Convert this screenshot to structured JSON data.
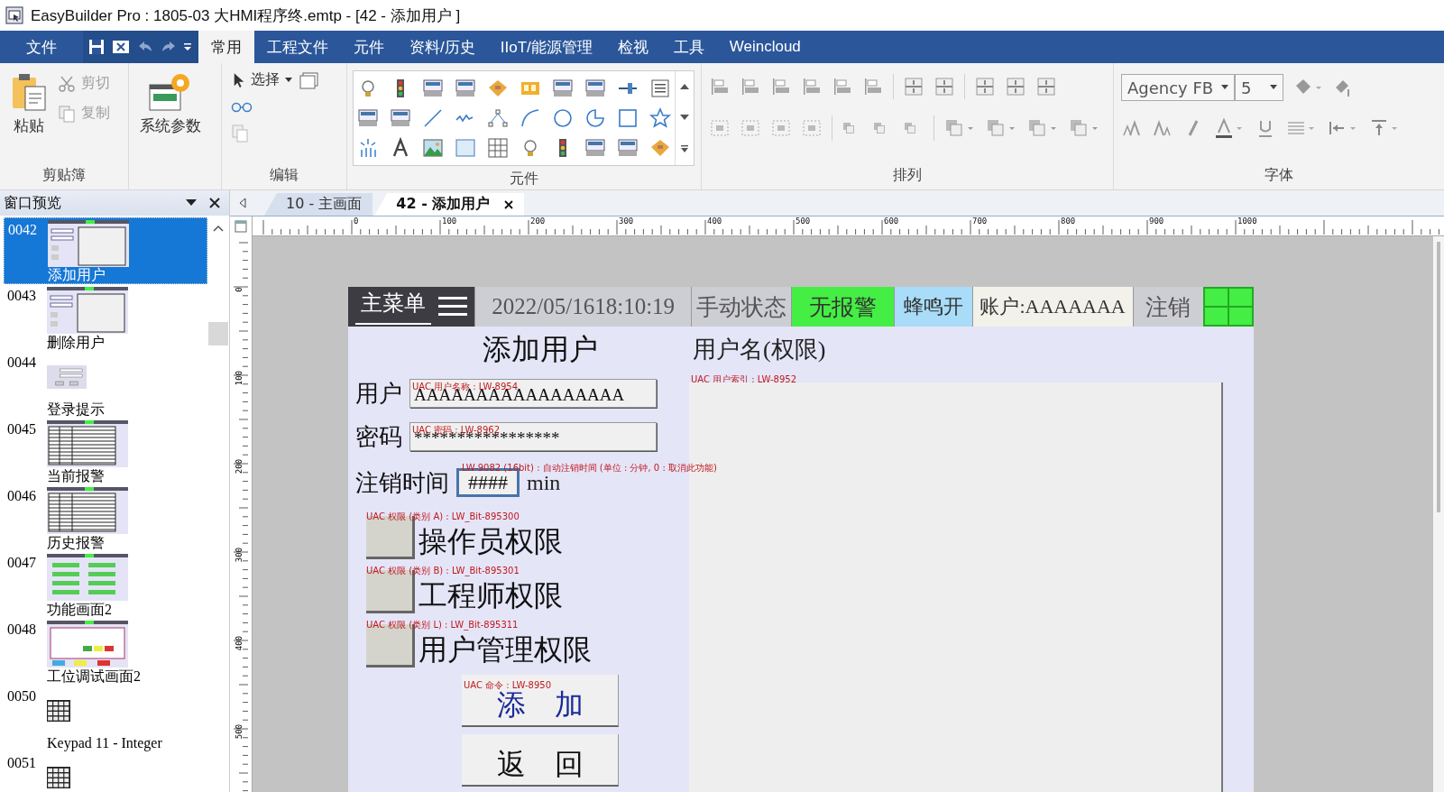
{
  "window": {
    "title": "EasyBuilder Pro : 1805-03 大HMI程序终.emtp - [42 - 添加用户 ]"
  },
  "menu": {
    "file": "文件",
    "tabs": [
      {
        "label": "常用",
        "selected": true
      },
      {
        "label": "工程文件",
        "selected": false
      },
      {
        "label": "元件",
        "selected": false
      },
      {
        "label": "资料/历史",
        "selected": false
      },
      {
        "label": "IIoT/能源管理",
        "selected": false
      },
      {
        "label": "检视",
        "selected": false
      },
      {
        "label": "工具",
        "selected": false
      },
      {
        "label": "Weincloud",
        "selected": false
      }
    ]
  },
  "ribbon": {
    "clipboard": {
      "label": "剪贴簿",
      "paste": {
        "label": "粘贴",
        "disabled": false
      },
      "actions": [
        {
          "label": "剪切",
          "disabled": true
        },
        {
          "label": "复制",
          "disabled": true
        }
      ]
    },
    "system": {
      "label": "系统参数"
    },
    "edit": {
      "label": "编辑",
      "select": "选择"
    },
    "objects": {
      "label": "元件"
    },
    "arrange": {
      "label": "排列"
    },
    "font": {
      "label": "字体",
      "family": "Agency FB",
      "size": "5"
    }
  },
  "window_preview": {
    "title": "窗口预览",
    "items": [
      {
        "number": "0042",
        "name": "添加用户",
        "kind": "form",
        "selected": true
      },
      {
        "number": "0043",
        "name": "删除用户",
        "kind": "form",
        "selected": false
      },
      {
        "number": "0044",
        "name": "登录提示",
        "kind": "dialog",
        "selected": false
      },
      {
        "number": "0045",
        "name": "当前报警",
        "kind": "table",
        "selected": false
      },
      {
        "number": "0046",
        "name": "历史报警",
        "kind": "table",
        "selected": false
      },
      {
        "number": "0047",
        "name": "功能画面2",
        "kind": "buttons",
        "selected": false
      },
      {
        "number": "0048",
        "name": "工位调试画面2",
        "kind": "panel",
        "selected": false
      },
      {
        "number": "0050",
        "name": "Keypad 11 - Integer",
        "kind": "keypad",
        "selected": false
      },
      {
        "number": "0051",
        "kind": "keypad",
        "selected": false
      }
    ]
  },
  "doc_tabs": [
    {
      "label": "10 - 主画面",
      "selected": false
    },
    {
      "label": "42 - 添加用户",
      "selected": true
    }
  ],
  "ruler": {
    "horizontal": [
      "0",
      "100",
      "200",
      "300",
      "400",
      "500",
      "600",
      "700",
      "800",
      "900",
      "1000"
    ],
    "vertical": [
      "0",
      "100",
      "200",
      "300",
      "400",
      "500"
    ]
  },
  "hmi": {
    "header": {
      "menu": "主菜单",
      "datetime": "2022/05/1618:10:19",
      "mode": "手动状态",
      "alarm": "无报警",
      "buzzer": "蜂鸣开",
      "account": "账户:AAAAAAA",
      "logout": "注销"
    },
    "title": "添加用户",
    "fields": [
      {
        "label": "用户",
        "tag": "UAC 用户名称 : LW-8954",
        "value": "AAAAAAAAAAAAAAAAA"
      },
      {
        "label": "密码",
        "tag": "UAC 密码 : LW-8962",
        "value": "*****************"
      }
    ],
    "timeout": {
      "label": "注销时间",
      "tag": "LW-9082 (16bit) : 自动注销时间 (单位 : 分钟, 0 : 取消此功能)",
      "value": "####",
      "unit": "min"
    },
    "permissions": [
      {
        "tag": "UAC 权限 (类别 A) : LW_Bit-895300",
        "label": "操作员权限"
      },
      {
        "tag": "UAC 权限 (类别 B) : LW_Bit-895301",
        "label": "工程师权限"
      },
      {
        "tag": "UAC 权限 (类别 L) : LW_Bit-895311",
        "label": "用户管理权限"
      }
    ],
    "buttons": [
      {
        "tag": "UAC 命令 : LW-8950",
        "label": "添　加",
        "kind": "command"
      },
      {
        "label": "返　回",
        "kind": "plain"
      }
    ],
    "user_list": {
      "title": "用户名(权限)",
      "tag": "UAC 用户索引 : LW-8952"
    }
  }
}
